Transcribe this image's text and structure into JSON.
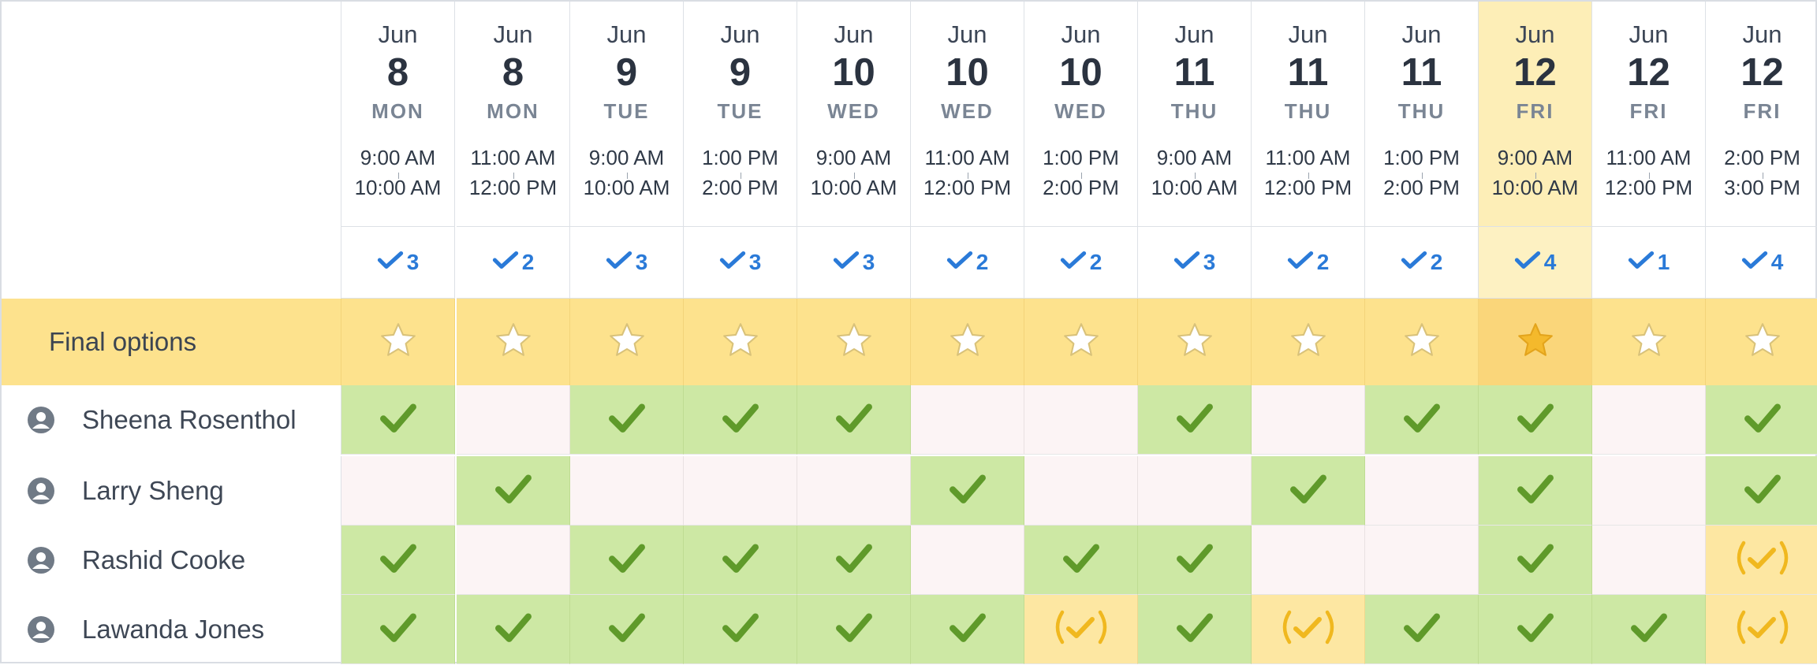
{
  "final_options_label": "Final options",
  "selected_index": 10,
  "colors": {
    "accent": "#2a7ad8",
    "yes": "#cde8a4",
    "no": "#fcf4f5",
    "maybe": "#fde7a2",
    "star_row": "#fde28d",
    "star_selected": "#f4b92c"
  },
  "options": [
    {
      "month": "Jun",
      "day": "8",
      "dow": "MON",
      "start": "9:00 AM",
      "end": "10:00 AM",
      "count": "3"
    },
    {
      "month": "Jun",
      "day": "8",
      "dow": "MON",
      "start": "11:00 AM",
      "end": "12:00 PM",
      "count": "2"
    },
    {
      "month": "Jun",
      "day": "9",
      "dow": "TUE",
      "start": "9:00 AM",
      "end": "10:00 AM",
      "count": "3"
    },
    {
      "month": "Jun",
      "day": "9",
      "dow": "TUE",
      "start": "1:00 PM",
      "end": "2:00 PM",
      "count": "3"
    },
    {
      "month": "Jun",
      "day": "10",
      "dow": "WED",
      "start": "9:00 AM",
      "end": "10:00 AM",
      "count": "3"
    },
    {
      "month": "Jun",
      "day": "10",
      "dow": "WED",
      "start": "11:00 AM",
      "end": "12:00 PM",
      "count": "2"
    },
    {
      "month": "Jun",
      "day": "10",
      "dow": "WED",
      "start": "1:00 PM",
      "end": "2:00 PM",
      "count": "2"
    },
    {
      "month": "Jun",
      "day": "11",
      "dow": "THU",
      "start": "9:00 AM",
      "end": "10:00 AM",
      "count": "3"
    },
    {
      "month": "Jun",
      "day": "11",
      "dow": "THU",
      "start": "11:00 AM",
      "end": "12:00 PM",
      "count": "2"
    },
    {
      "month": "Jun",
      "day": "11",
      "dow": "THU",
      "start": "1:00 PM",
      "end": "2:00 PM",
      "count": "2"
    },
    {
      "month": "Jun",
      "day": "12",
      "dow": "FRI",
      "start": "9:00 AM",
      "end": "10:00 AM",
      "count": "4"
    },
    {
      "month": "Jun",
      "day": "12",
      "dow": "FRI",
      "start": "11:00 AM",
      "end": "12:00 PM",
      "count": "1"
    },
    {
      "month": "Jun",
      "day": "12",
      "dow": "FRI",
      "start": "2:00 PM",
      "end": "3:00 PM",
      "count": "4"
    }
  ],
  "participants": [
    {
      "name": "Sheena Rosenthol",
      "votes": [
        "yes",
        "no",
        "yes",
        "yes",
        "yes",
        "no",
        "no",
        "yes",
        "no",
        "yes",
        "yes",
        "no",
        "yes"
      ]
    },
    {
      "name": "Larry Sheng",
      "votes": [
        "no",
        "yes",
        "no",
        "no",
        "no",
        "yes",
        "no",
        "no",
        "yes",
        "no",
        "yes",
        "no",
        "yes"
      ]
    },
    {
      "name": "Rashid Cooke",
      "votes": [
        "yes",
        "no",
        "yes",
        "yes",
        "yes",
        "no",
        "yes",
        "yes",
        "no",
        "no",
        "yes",
        "no",
        "maybe"
      ]
    },
    {
      "name": "Lawanda Jones",
      "votes": [
        "yes",
        "yes",
        "yes",
        "yes",
        "yes",
        "yes",
        "maybe",
        "yes",
        "maybe",
        "yes",
        "yes",
        "yes",
        "maybe"
      ]
    }
  ]
}
